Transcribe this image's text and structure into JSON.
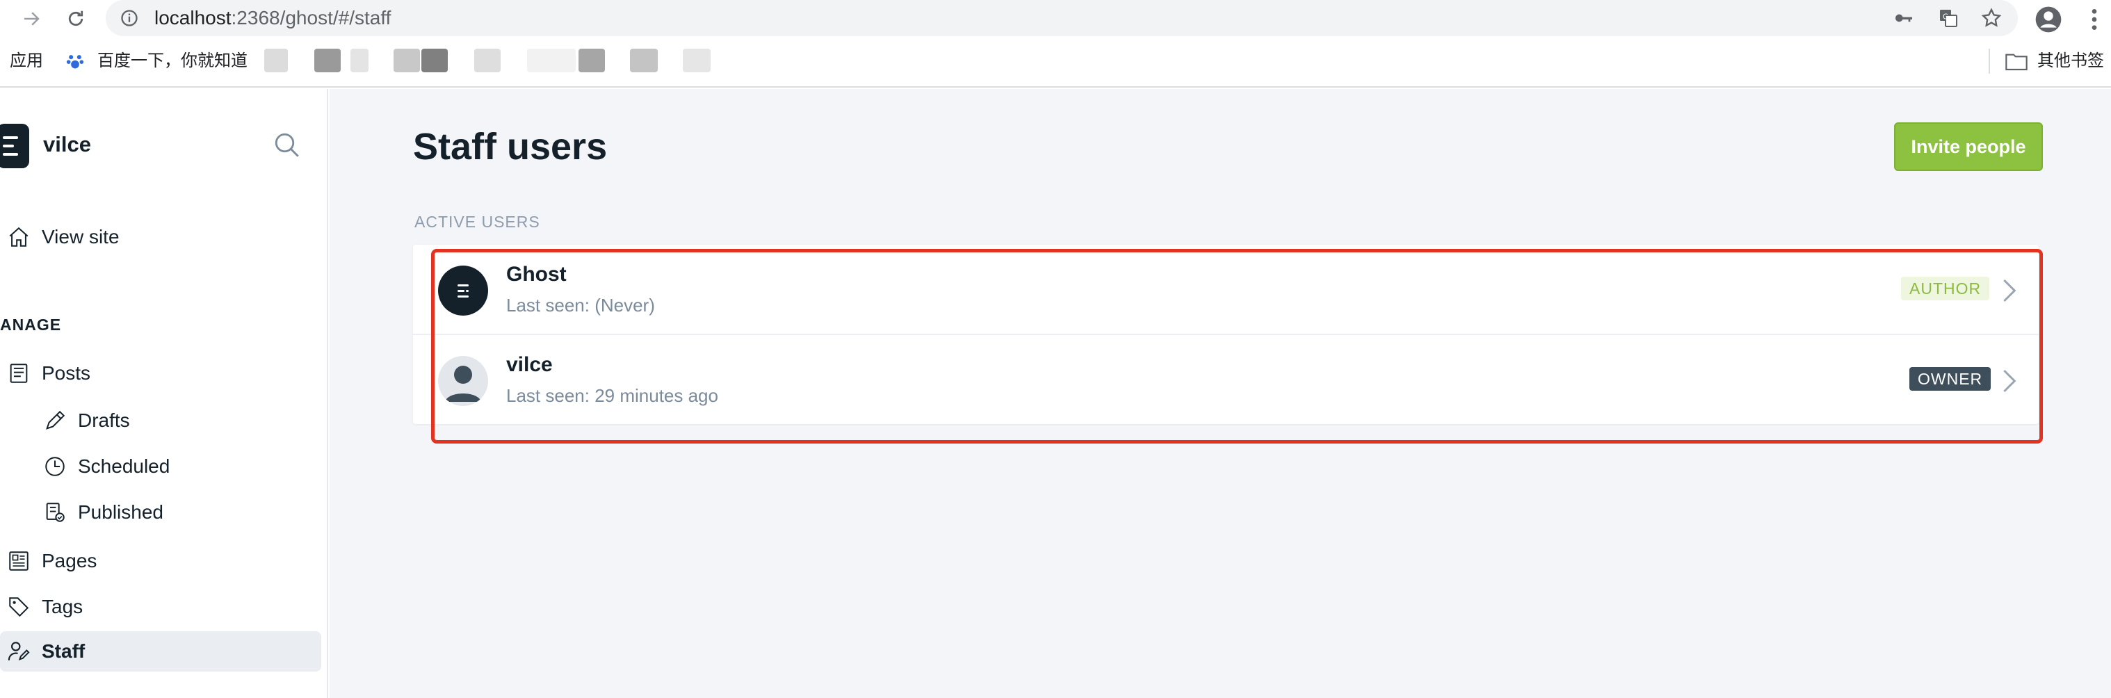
{
  "browser": {
    "url_host": "localhost",
    "url_path": ":2368/ghost/#/staff"
  },
  "bookmarks": {
    "apps_label": "应用",
    "baidu_label": "百度一下，你就知道",
    "other_bookmarks_label": "其他书签"
  },
  "sidebar": {
    "brand_name": "vilce",
    "view_site": "View site",
    "section_label": "ANAGE",
    "items": {
      "posts": "Posts",
      "drafts": "Drafts",
      "scheduled": "Scheduled",
      "published": "Published",
      "pages": "Pages",
      "tags": "Tags",
      "staff": "Staff"
    }
  },
  "main": {
    "title": "Staff users",
    "invite_button": "Invite people",
    "list_header": "ACTIVE USERS",
    "users": [
      {
        "name": "Ghost",
        "last_seen": "Last seen: (Never)",
        "role": "AUTHOR"
      },
      {
        "name": "vilce",
        "last_seen": "Last seen: 29 minutes ago",
        "role": "OWNER"
      }
    ]
  },
  "colors": {
    "accent_green": "#8cc23f",
    "highlight_red": "#e3321f",
    "dark": "#15212a"
  }
}
